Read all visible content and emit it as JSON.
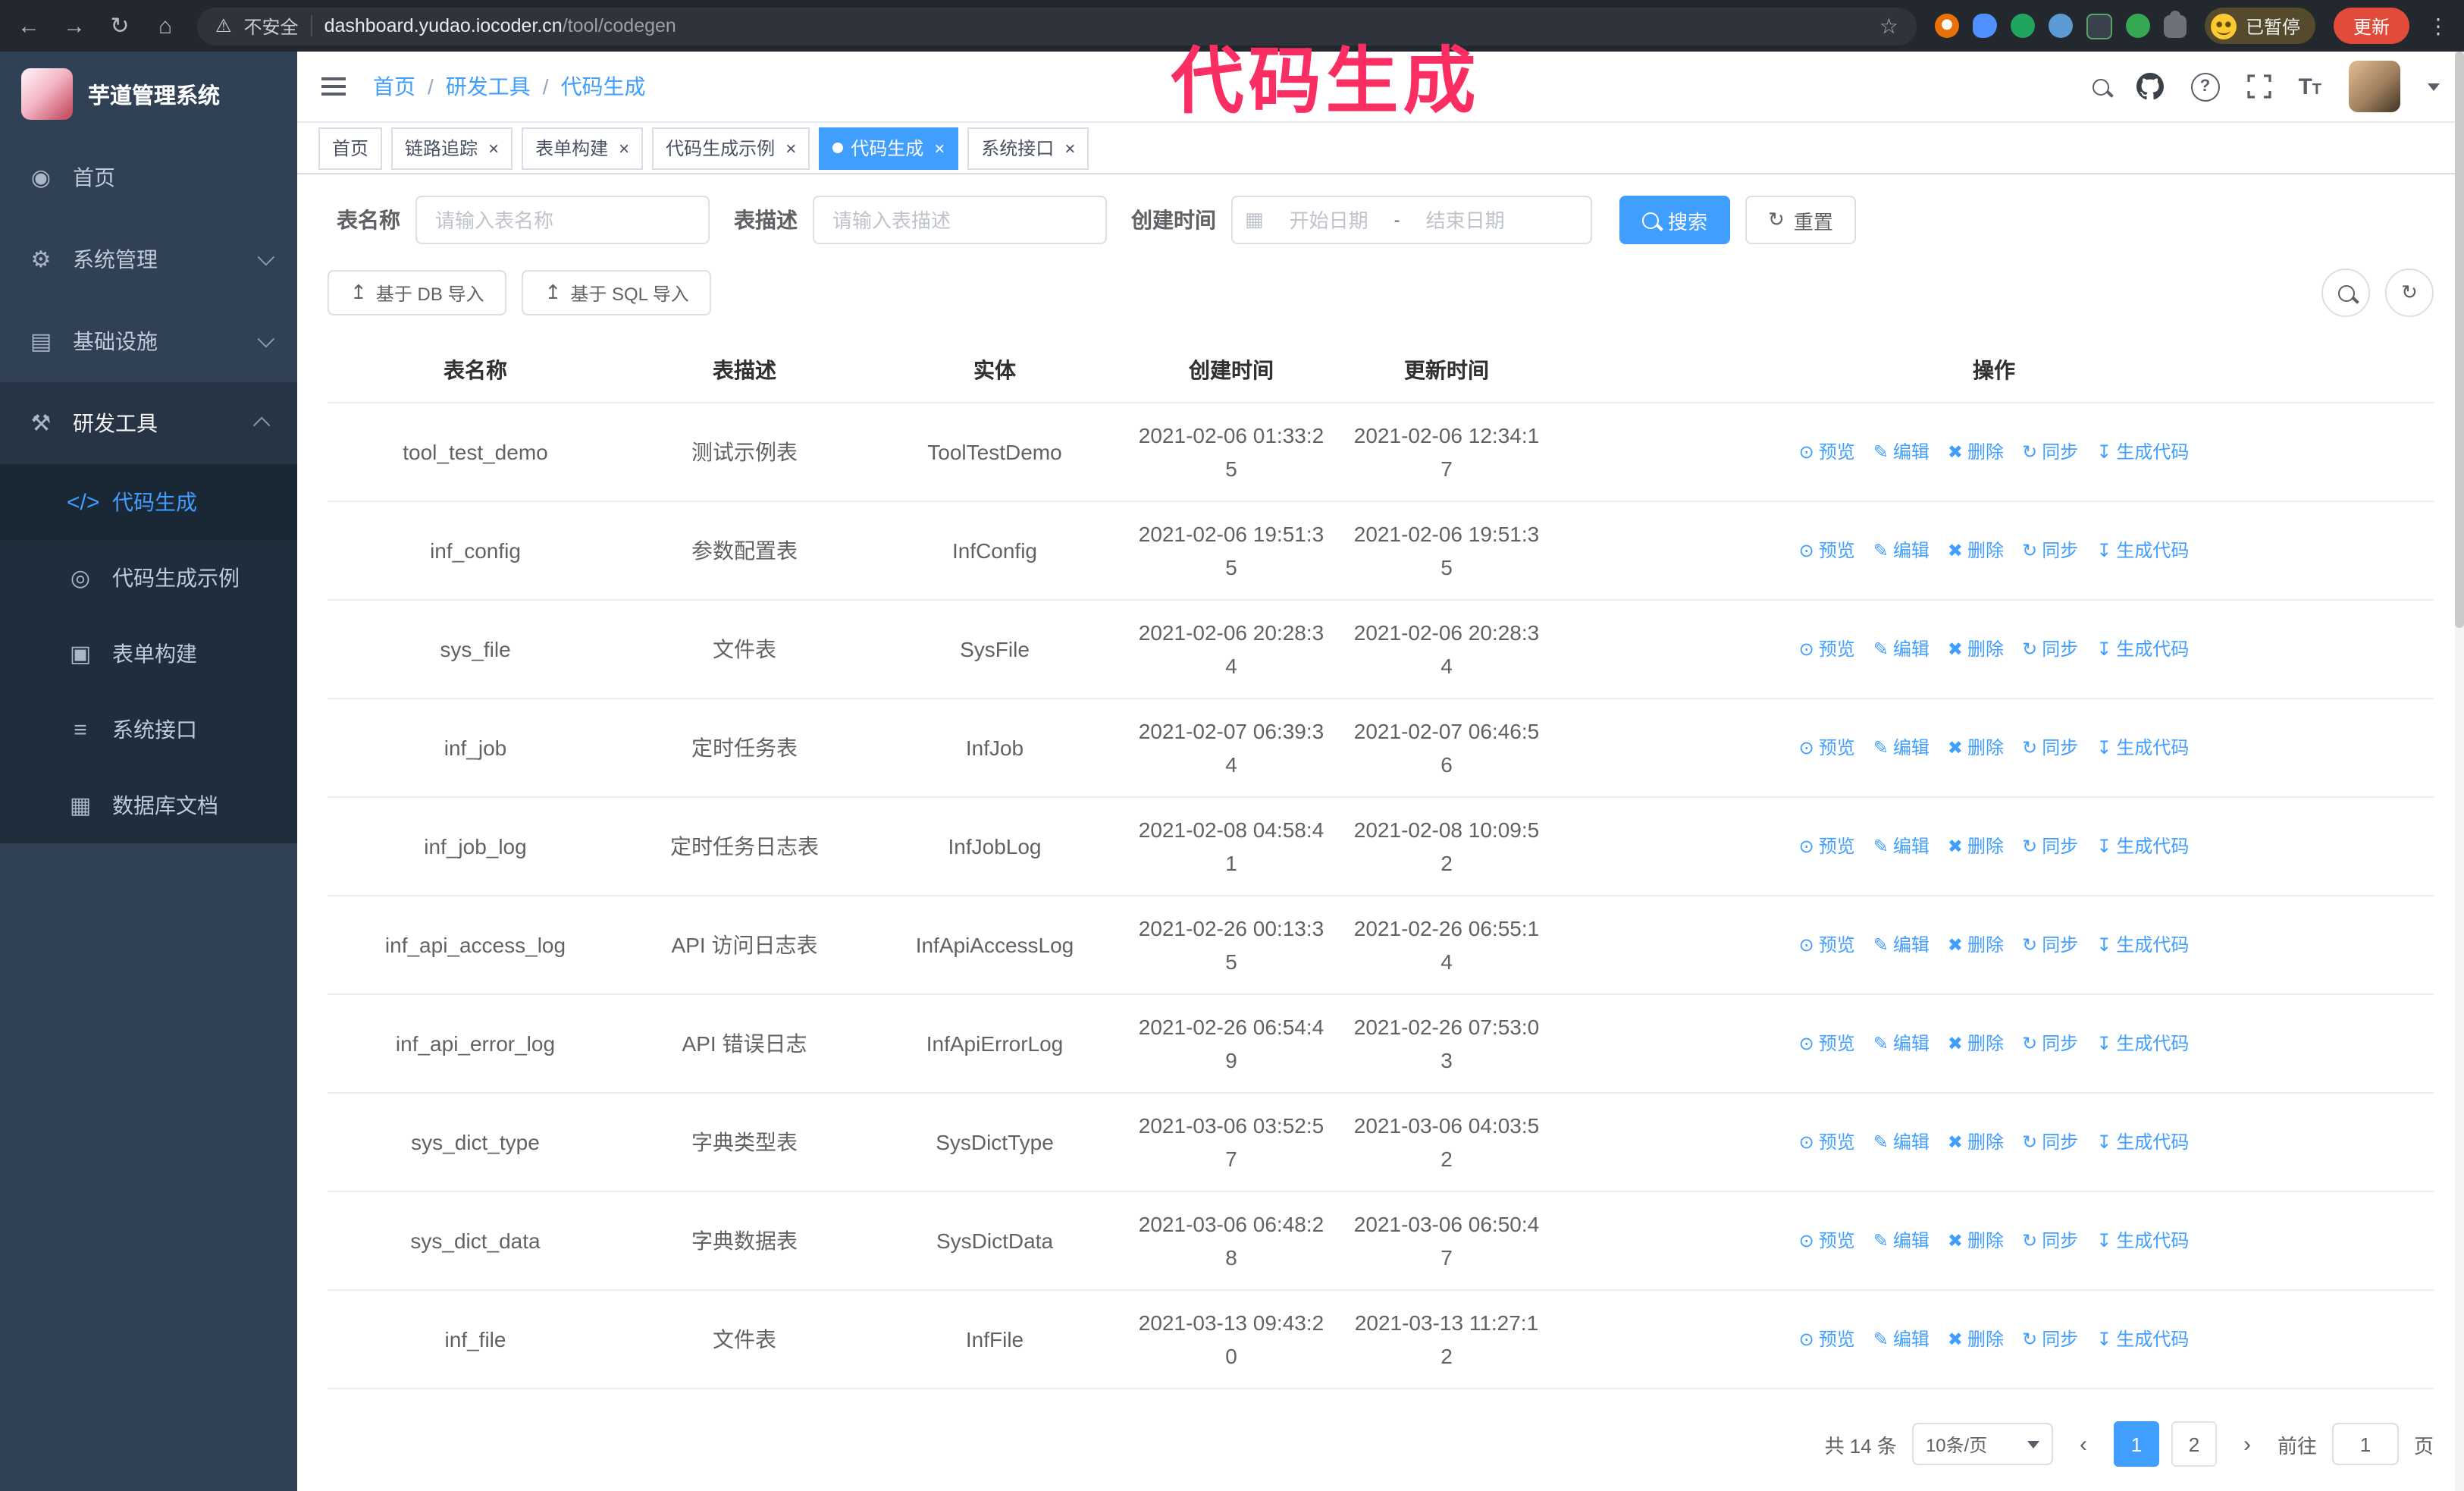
{
  "colors": {
    "accent": "#409EFF",
    "annotation": "#FB2E63",
    "tab_active": "#409EFF",
    "update_button": "#E24B3B",
    "sidebar_bg": "#304156",
    "submenu_bg": "#1F2D3D"
  },
  "annotation": {
    "text": "代码生成"
  },
  "icons": {
    "back": "←",
    "forward": "→",
    "reload": "↻",
    "home": "⌂",
    "warning": "⚠",
    "star": "☆",
    "more_dots": "⋮",
    "close": "×",
    "question": "?",
    "font_size": "T",
    "calendar": "▦",
    "upload": "↥",
    "refresh": "↻",
    "prev": "‹",
    "next": "›"
  },
  "browser": {
    "security_text": "不安全",
    "url_host": "dashboard.yudao.iocoder.cn",
    "url_path": "/tool/codegen",
    "profile_badge": "已暂停",
    "update_button": "更新"
  },
  "sidebar": {
    "logo_title": "芋道管理系统",
    "items": [
      {
        "label": "首页",
        "icon": "◉",
        "icon_name": "dashboard-icon",
        "has_children": false,
        "expanded": false,
        "active": false
      },
      {
        "label": "系统管理",
        "icon": "⚙",
        "icon_name": "gear-icon",
        "has_children": true,
        "expanded": false,
        "active": false
      },
      {
        "label": "基础设施",
        "icon": "▤",
        "icon_name": "infrastructure-icon",
        "has_children": true,
        "expanded": false,
        "active": false
      },
      {
        "label": "研发工具",
        "icon": "⚒",
        "icon_name": "tools-icon",
        "has_children": true,
        "expanded": true,
        "active": true
      }
    ],
    "subitems": [
      {
        "label": "代码生成",
        "icon": "</>",
        "icon_name": "code-generate-icon",
        "active": true
      },
      {
        "label": "代码生成示例",
        "icon": "◎",
        "icon_name": "code-example-icon",
        "active": false
      },
      {
        "label": "表单构建",
        "icon": "▣",
        "icon_name": "form-builder-icon",
        "active": false
      },
      {
        "label": "系统接口",
        "icon": "≡",
        "icon_name": "system-api-icon",
        "active": false
      },
      {
        "label": "数据库文档",
        "icon": "▦",
        "icon_name": "db-doc-icon",
        "active": false
      }
    ]
  },
  "header": {
    "breadcrumb": [
      {
        "label": "首页"
      },
      {
        "label": "研发工具"
      },
      {
        "label": "代码生成"
      }
    ]
  },
  "tabs": [
    {
      "label": "首页",
      "closable": false,
      "active": false
    },
    {
      "label": "链路追踪",
      "closable": true,
      "active": false
    },
    {
      "label": "表单构建",
      "closable": true,
      "active": false
    },
    {
      "label": "代码生成示例",
      "closable": true,
      "active": false
    },
    {
      "label": "代码生成",
      "closable": true,
      "active": true
    },
    {
      "label": "系统接口",
      "closable": true,
      "active": false
    }
  ],
  "filters": {
    "name_label": "表名称",
    "name_placeholder": "请输入表名称",
    "desc_label": "表描述",
    "desc_placeholder": "请输入表描述",
    "time_label": "创建时间",
    "start_placeholder": "开始日期",
    "range_separator": "-",
    "end_placeholder": "结束日期",
    "search_label": "搜索",
    "reset_label": "重置"
  },
  "toolbar": {
    "import_db_label": "基于 DB 导入",
    "import_sql_label": "基于 SQL 导入"
  },
  "table": {
    "columns": [
      "表名称",
      "表描述",
      "实体",
      "创建时间",
      "更新时间",
      "操作"
    ],
    "actions": [
      {
        "label": "预览",
        "icon": "⊙",
        "name": "preview-link"
      },
      {
        "label": "编辑",
        "icon": "✎",
        "name": "edit-link"
      },
      {
        "label": "删除",
        "icon": "✖",
        "name": "delete-link"
      },
      {
        "label": "同步",
        "icon": "↻",
        "name": "sync-link"
      },
      {
        "label": "生成代码",
        "icon": "↧",
        "name": "generate-code-link"
      }
    ],
    "rows": [
      {
        "name": "tool_test_demo",
        "desc": "测试示例表",
        "entity": "ToolTestDemo",
        "created": "2021-02-06 01:33:25",
        "updated": "2021-02-06 12:34:17"
      },
      {
        "name": "inf_config",
        "desc": "参数配置表",
        "entity": "InfConfig",
        "created": "2021-02-06 19:51:35",
        "updated": "2021-02-06 19:51:35"
      },
      {
        "name": "sys_file",
        "desc": "文件表",
        "entity": "SysFile",
        "created": "2021-02-06 20:28:34",
        "updated": "2021-02-06 20:28:34"
      },
      {
        "name": "inf_job",
        "desc": "定时任务表",
        "entity": "InfJob",
        "created": "2021-02-07 06:39:34",
        "updated": "2021-02-07 06:46:56"
      },
      {
        "name": "inf_job_log",
        "desc": "定时任务日志表",
        "entity": "InfJobLog",
        "created": "2021-02-08 04:58:41",
        "updated": "2021-02-08 10:09:52"
      },
      {
        "name": "inf_api_access_log",
        "desc": "API 访问日志表",
        "entity": "InfApiAccessLog",
        "created": "2021-02-26 00:13:35",
        "updated": "2021-02-26 06:55:14"
      },
      {
        "name": "inf_api_error_log",
        "desc": "API 错误日志",
        "entity": "InfApiErrorLog",
        "created": "2021-02-26 06:54:49",
        "updated": "2021-02-26 07:53:03"
      },
      {
        "name": "sys_dict_type",
        "desc": "字典类型表",
        "entity": "SysDictType",
        "created": "2021-03-06 03:52:57",
        "updated": "2021-03-06 04:03:52"
      },
      {
        "name": "sys_dict_data",
        "desc": "字典数据表",
        "entity": "SysDictData",
        "created": "2021-03-06 06:48:28",
        "updated": "2021-03-06 06:50:47"
      },
      {
        "name": "inf_file",
        "desc": "文件表",
        "entity": "InfFile",
        "created": "2021-03-13 09:43:20",
        "updated": "2021-03-13 11:27:12"
      }
    ]
  },
  "pagination": {
    "total_label": "共 14 条",
    "page_size": "10条/页",
    "pages": [
      {
        "label": "1",
        "active": true
      },
      {
        "label": "2",
        "active": false
      }
    ],
    "goto_prefix": "前往",
    "goto_value": "1",
    "goto_suffix": "页"
  }
}
